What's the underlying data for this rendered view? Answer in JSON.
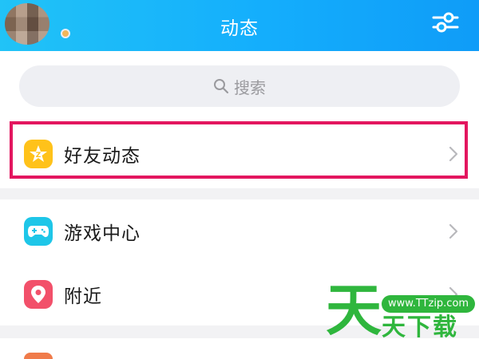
{
  "header": {
    "title": "动态",
    "avatar_icon": "avatar",
    "filter_icon": "filter-settings-icon"
  },
  "search": {
    "placeholder": "搜索",
    "icon": "search-icon"
  },
  "list": {
    "friends_feed": {
      "label": "好友动态",
      "icon": "qzone-star-icon",
      "highlighted": true
    },
    "game_center": {
      "label": "游戏中心",
      "icon": "gamepad-icon"
    },
    "nearby": {
      "label": "附近",
      "icon": "location-pin-icon"
    }
  },
  "colors": {
    "header_start": "#21c3f7",
    "header_end": "#0f9cf8",
    "highlight_border": "#e3165f",
    "qzone_yellow": "#ffc21a",
    "game_cyan": "#1ec6e8",
    "nearby_red": "#f2506a"
  },
  "watermark": {
    "big_char": "天",
    "url": "www.TTzip.com",
    "text": "天下载"
  }
}
